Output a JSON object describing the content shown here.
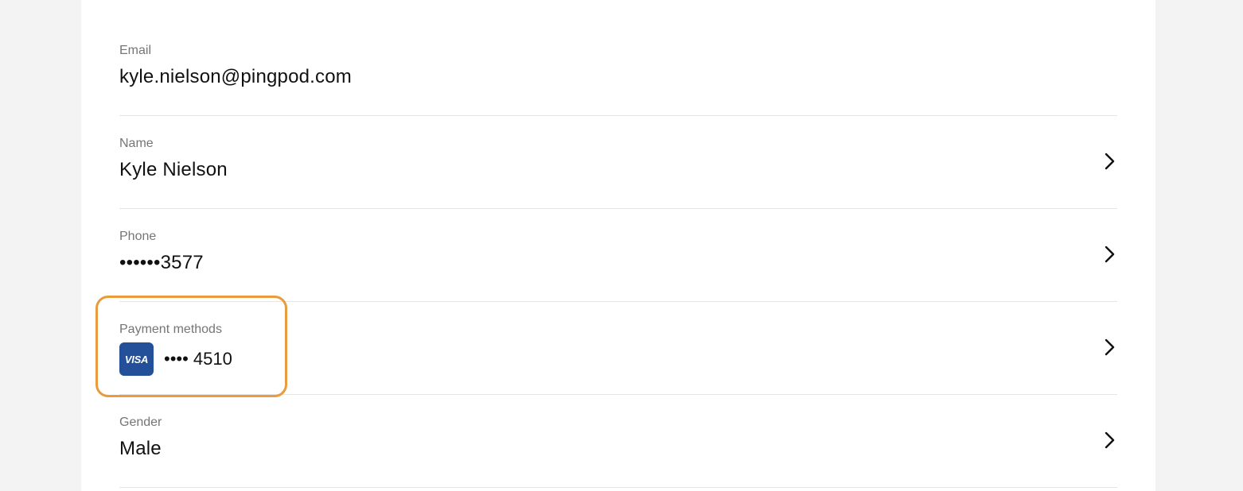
{
  "email": {
    "label": "Email",
    "value": "kyle.nielson@pingpod.com"
  },
  "name": {
    "label": "Name",
    "value": "Kyle Nielson"
  },
  "phone": {
    "label": "Phone",
    "value": "••••••3577"
  },
  "payment": {
    "label": "Payment methods",
    "card_brand": "VISA",
    "card_digits": "•••• 4510"
  },
  "gender": {
    "label": "Gender",
    "value": "Male"
  },
  "colors": {
    "highlight": "#e99b3d",
    "visa_blue": "#24509a"
  },
  "icons": {
    "row_chevron": "chevron-right-icon"
  }
}
